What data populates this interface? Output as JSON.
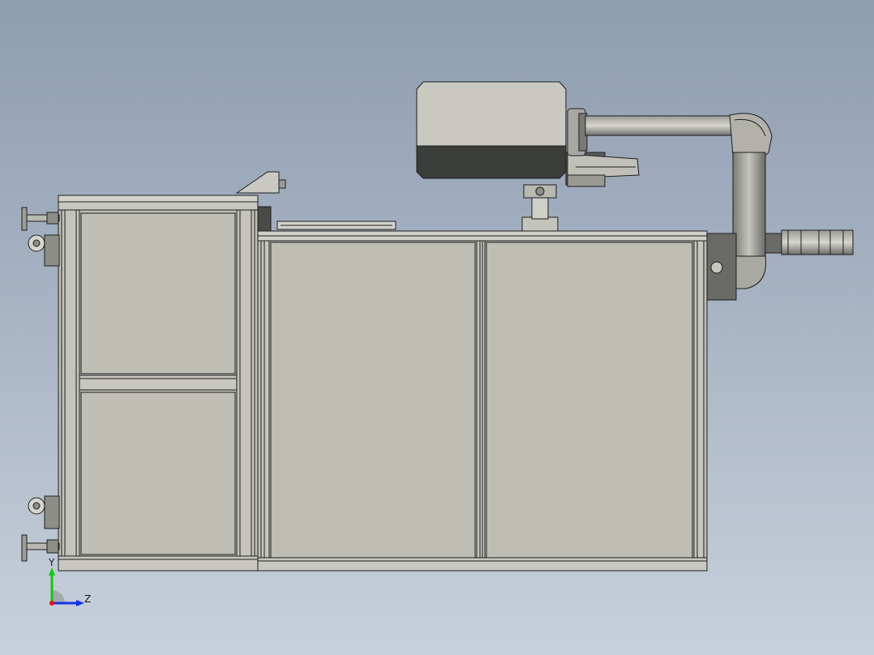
{
  "view": {
    "background_top": "#8f9db1",
    "background_bottom": "#c8d0db",
    "body_color": "#bfbfb6",
    "edge_color": "#1e1e1e",
    "robot_dark": "#3b3d3b",
    "robot_light": "#c9c9c2"
  },
  "triad": {
    "y_label": "Y",
    "z_label": "Z",
    "y_color": "#14c814",
    "z_color": "#1432e6",
    "origin_color": "#e61414"
  }
}
